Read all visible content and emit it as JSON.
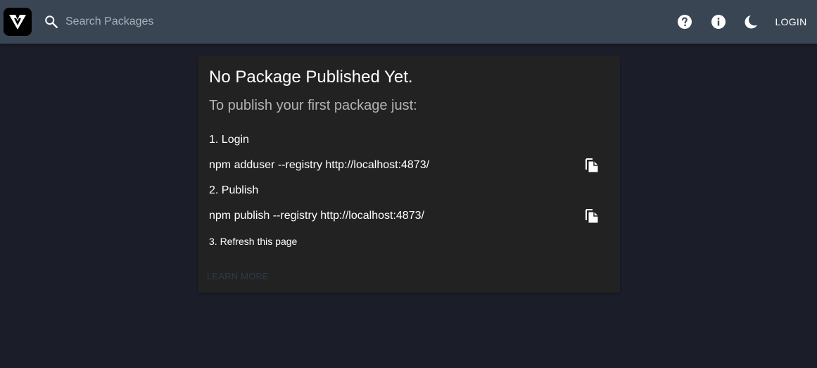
{
  "header": {
    "logo_icon": "verdaccio-logo-icon",
    "search": {
      "placeholder": "Search Packages",
      "value": ""
    },
    "help_icon": "help-circle-icon",
    "info_icon": "info-icon",
    "theme_icon": "moon-icon",
    "login_label": "LOGIN"
  },
  "card": {
    "title": "No Package Published Yet.",
    "subtitle": "To publish your first package just:",
    "steps": [
      {
        "label": "1. Login",
        "command": "npm adduser --registry http://localhost:4873/"
      },
      {
        "label": "2. Publish",
        "command": "npm publish --registry http://localhost:4873/"
      }
    ],
    "refresh": "3. Refresh this page",
    "copy_icon": "copy-icon",
    "learn_more": "LEARN MORE"
  },
  "colors": {
    "appbar": "#394553",
    "background": "#1b1e29",
    "card": "#222222",
    "learn_more": "#2d3a4a"
  }
}
